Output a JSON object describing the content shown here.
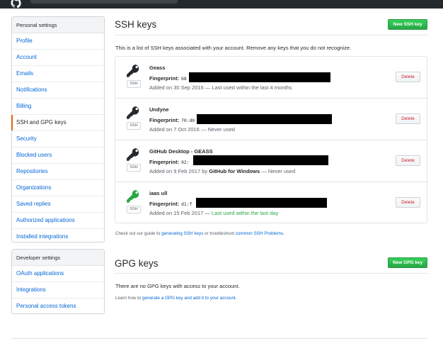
{
  "colors": {
    "accent": "#0366d6",
    "green": "#28a745",
    "danger": "#cb2431",
    "selected_marker": "#e36209"
  },
  "personal_menu": {
    "heading": "Personal settings",
    "items": [
      {
        "label": "Profile"
      },
      {
        "label": "Account"
      },
      {
        "label": "Emails"
      },
      {
        "label": "Notifications"
      },
      {
        "label": "Billing"
      },
      {
        "label": "SSH and GPG keys",
        "selected": true
      },
      {
        "label": "Security"
      },
      {
        "label": "Blocked users"
      },
      {
        "label": "Repositories"
      },
      {
        "label": "Organizations"
      },
      {
        "label": "Saved replies"
      },
      {
        "label": "Authorized applications"
      },
      {
        "label": "Installed integrations"
      }
    ]
  },
  "developer_menu": {
    "heading": "Developer settings",
    "items": [
      {
        "label": "OAuth applications"
      },
      {
        "label": "Integrations"
      },
      {
        "label": "Personal access tokens"
      }
    ]
  },
  "ssh": {
    "title": "SSH keys",
    "new_button": "New SSH key",
    "intro": "This is a list of SSH keys associated with your account. Remove any keys that you do not recognize.",
    "keys": [
      {
        "title": "Geass",
        "fingerprint_label": "Fingerprint:",
        "fingerprint": "68",
        "added": "Added on 30 Sep 2016",
        "sep": " — ",
        "usage": "Last used within the last 4 months",
        "usage_green": false,
        "via": "",
        "badge": "SSH",
        "delete": "Delete",
        "icon_color": "#24292e"
      },
      {
        "title": "Undyne",
        "fingerprint_label": "Fingerprint:",
        "fingerprint": "70:d0",
        "added": "Added on 7 Oct 2016",
        "sep": " — ",
        "usage": "Never used",
        "usage_green": false,
        "via": "",
        "badge": "SSH",
        "delete": "Delete",
        "icon_color": "#24292e"
      },
      {
        "title": "GitHub Desktop - GEASS",
        "fingerprint_label": "Fingerprint:",
        "fingerprint": "02:",
        "added": "Added on 9 Feb 2017 by ",
        "sep": " — ",
        "usage": "Never used",
        "usage_green": false,
        "via": "GitHub for Windows",
        "badge": "SSH",
        "delete": "Delete",
        "icon_color": "#24292e"
      },
      {
        "title": "iaas ull",
        "fingerprint_label": "Fingerprint:",
        "fingerprint": "d1:f",
        "added": "Added on 15 Feb 2017",
        "sep": " — ",
        "usage": "Last used within the last day",
        "usage_green": true,
        "via": "",
        "badge": "SSH",
        "delete": "Delete",
        "icon_color": "#28a745"
      }
    ],
    "note_prefix": "Check out our guide to ",
    "note_link1": "generating SSH keys",
    "note_middle": " or troubleshoot ",
    "note_link2": "common SSH Problems",
    "note_suffix": "."
  },
  "gpg": {
    "title": "GPG keys",
    "new_button": "New GPG key",
    "empty": "There are no GPG keys with access to your account.",
    "note_prefix": "Learn how to ",
    "note_link": "generate a GPG key and add it to your account",
    "note_suffix": "."
  }
}
